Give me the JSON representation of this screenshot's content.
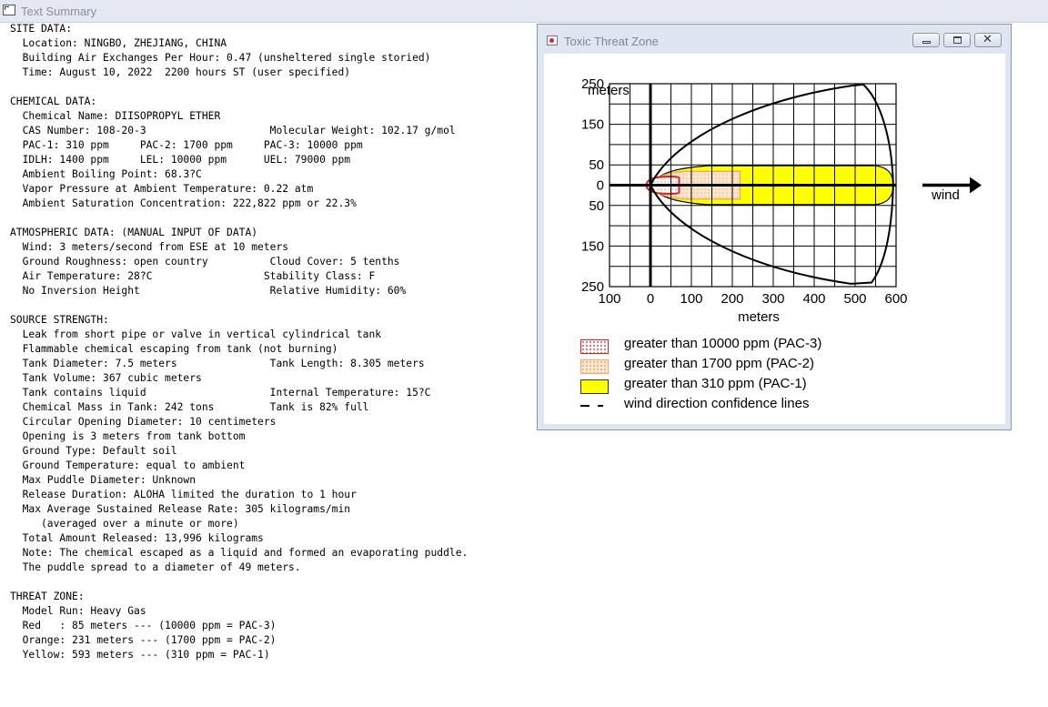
{
  "main_window": {
    "title": "Text Summary"
  },
  "summary_lines": [
    "SITE DATA:",
    "  Location: NINGBO, ZHEJIANG, CHINA",
    "  Building Air Exchanges Per Hour: 0.47 (unsheltered single storied)",
    "  Time: August 10, 2022  2200 hours ST (user specified)",
    "",
    "CHEMICAL DATA:",
    "  Chemical Name: DIISOPROPYL ETHER",
    "  CAS Number: 108-20-3                    Molecular Weight: 102.17 g/mol",
    "  PAC-1: 310 ppm     PAC-2: 1700 ppm     PAC-3: 10000 ppm",
    "  IDLH: 1400 ppm     LEL: 10000 ppm      UEL: 79000 ppm",
    "  Ambient Boiling Point: 68.3?C",
    "  Vapor Pressure at Ambient Temperature: 0.22 atm",
    "  Ambient Saturation Concentration: 222,822 ppm or 22.3%",
    "",
    "ATMOSPHERIC DATA: (MANUAL INPUT OF DATA)",
    "  Wind: 3 meters/second from ESE at 10 meters",
    "  Ground Roughness: open country          Cloud Cover: 5 tenths",
    "  Air Temperature: 28?C                  Stability Class: F",
    "  No Inversion Height                     Relative Humidity: 60%",
    "",
    "SOURCE STRENGTH:",
    "  Leak from short pipe or valve in vertical cylindrical tank",
    "  Flammable chemical escaping from tank (not burning)",
    "  Tank Diameter: 7.5 meters               Tank Length: 8.305 meters",
    "  Tank Volume: 367 cubic meters",
    "  Tank contains liquid                    Internal Temperature: 15?C",
    "  Chemical Mass in Tank: 242 tons         Tank is 82% full",
    "  Circular Opening Diameter: 10 centimeters",
    "  Opening is 3 meters from tank bottom",
    "  Ground Type: Default soil",
    "  Ground Temperature: equal to ambient",
    "  Max Puddle Diameter: Unknown",
    "  Release Duration: ALOHA limited the duration to 1 hour",
    "  Max Average Sustained Release Rate: 305 kilograms/min",
    "     (averaged over a minute or more)",
    "  Total Amount Released: 13,996 kilograms",
    "  Note: The chemical escaped as a liquid and formed an evaporating puddle.",
    "  The puddle spread to a diameter of 49 meters.",
    "",
    "THREAT ZONE:",
    "  Model Run: Heavy Gas",
    "  Red   : 85 meters --- (10000 ppm = PAC-3)",
    "  Orange: 231 meters --- (1700 ppm = PAC-2)",
    "  Yellow: 593 meters --- (310 ppm = PAC-1)"
  ],
  "threat_window": {
    "title": "Toxic Threat Zone",
    "plot": {
      "y_label": "meters",
      "x_label": "meters",
      "y_ticks": [
        "250",
        "150",
        "50",
        "0",
        "50",
        "150",
        "250"
      ],
      "y_values": [
        250,
        150,
        50,
        0,
        -50,
        -150,
        -250
      ],
      "x_ticks": [
        "100",
        "0",
        "100",
        "200",
        "300",
        "400",
        "500",
        "600"
      ],
      "x_values": [
        -100,
        0,
        100,
        200,
        300,
        400,
        500,
        600
      ],
      "x_range": [
        -100,
        600
      ],
      "y_range": [
        -250,
        250
      ],
      "wind_label": "wind",
      "zone_colors": {
        "red": "#e02020",
        "orange": "#f0a868",
        "yellow": "#ffff00"
      },
      "zones": {
        "red_extent_m": 85,
        "orange_extent_m": 231,
        "yellow_extent_m": 593
      }
    },
    "legend": [
      {
        "swatch": "red-dotted",
        "label": "greater than 10000 ppm (PAC-3)"
      },
      {
        "swatch": "orange-dotted",
        "label": "greater than 1700 ppm (PAC-2)"
      },
      {
        "swatch": "yellow",
        "label": "greater than 310 ppm (PAC-1)"
      },
      {
        "swatch": "dashed-lines",
        "label": "wind direction confidence lines"
      }
    ]
  }
}
